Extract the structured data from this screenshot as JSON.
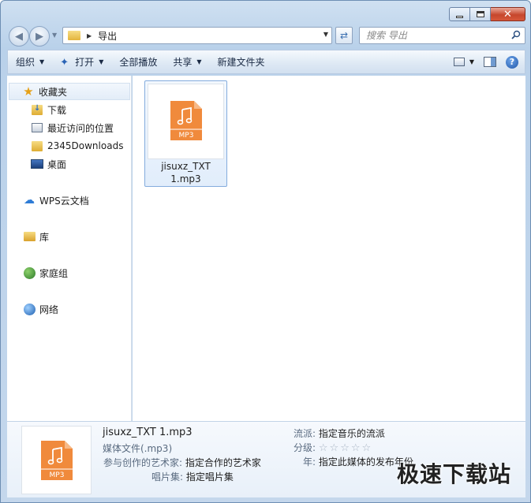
{
  "window": {
    "caption": {
      "minimize": "–",
      "close": "✕"
    }
  },
  "address_bar": {
    "path": "导出",
    "search_placeholder": "搜索 导出"
  },
  "toolbar": {
    "organize": "组织",
    "open": "打开",
    "play_all": "全部播放",
    "share": "共享",
    "new_folder": "新建文件夹"
  },
  "nav_pane": {
    "favorites": "收藏夹",
    "downloads": "下载",
    "recent": "最近访问的位置",
    "folder_2345": "2345Downloads",
    "desktop": "桌面",
    "wps_cloud": "WPS云文档",
    "libraries": "库",
    "homegroup": "家庭组",
    "network": "网络"
  },
  "files": [
    {
      "name_line1": "jisuxz_TXT",
      "name_line2": "1.mp3",
      "badge": "MP3"
    }
  ],
  "details": {
    "file_name": "jisuxz_TXT 1.mp3",
    "file_type": "媒体文件(.mp3)",
    "artist_label": "参与创作的艺术家:",
    "artist_value": "指定合作的艺术家",
    "album_label": "唱片集:",
    "album_value": "指定唱片集",
    "genre_label": "流派:",
    "genre_value": "指定音乐的流派",
    "rating_label": "分级:",
    "rating_stars": 0,
    "year_label": "年:",
    "year_value": "指定此媒体的发布年份",
    "badge": "MP3"
  },
  "watermark": "极速下载站",
  "colors": {
    "mp3_orange": "#f08a3c",
    "accent_blue": "#2a63b5"
  }
}
